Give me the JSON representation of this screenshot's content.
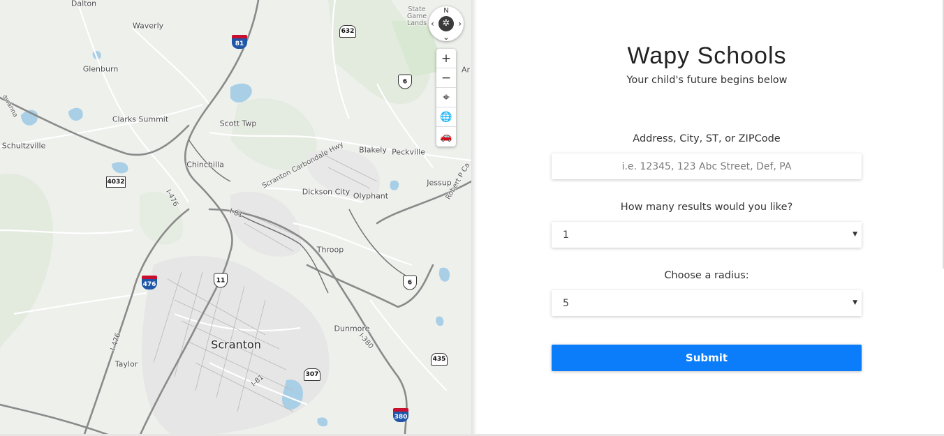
{
  "map": {
    "places": [
      {
        "name": "Dalton"
      },
      {
        "name": "Waverly"
      },
      {
        "name": "Glenburn"
      },
      {
        "name": "Clarks Summit"
      },
      {
        "name": "Scott Twp"
      },
      {
        "name": "Schultzville"
      },
      {
        "name": "Chinchilla"
      },
      {
        "name": "Blakely"
      },
      {
        "name": "Peckville"
      },
      {
        "name": "Dickson City"
      },
      {
        "name": "Olyphant"
      },
      {
        "name": "Jessup"
      },
      {
        "name": "Throop"
      },
      {
        "name": "Scranton"
      },
      {
        "name": "Dunmore"
      },
      {
        "name": "Taylor"
      },
      {
        "name": "State Game Lands"
      },
      {
        "name": "Ar"
      }
    ],
    "roads": [
      {
        "name": "Scranton Carbondale Hwy"
      },
      {
        "name": "I-476"
      },
      {
        "name": "I-81"
      },
      {
        "name": "I-380"
      },
      {
        "name": "I-476"
      },
      {
        "name": "I-81"
      },
      {
        "name": "Robert P Ca"
      },
      {
        "name": "awanna"
      }
    ],
    "shields": [
      {
        "num": "81",
        "type": "interstate"
      },
      {
        "num": "632",
        "type": "state"
      },
      {
        "num": "6",
        "type": "us"
      },
      {
        "num": "4032",
        "type": "county"
      },
      {
        "num": "476",
        "type": "interstate"
      },
      {
        "num": "11",
        "type": "us"
      },
      {
        "num": "6",
        "type": "us"
      },
      {
        "num": "307",
        "type": "state"
      },
      {
        "num": "435",
        "type": "state"
      },
      {
        "num": "380",
        "type": "interstate"
      }
    ],
    "controls": {
      "compass_label": "N",
      "zoom_in": "+",
      "zoom_out": "−",
      "locate": "⌖",
      "globe": "🌐",
      "car": "🚗"
    }
  },
  "form": {
    "title": "Wapy Schools",
    "subtitle": "Your child's future begins below",
    "address_label": "Address, City, ST, or ZIPCode",
    "address_placeholder": "i.e. 12345, 123 Abc Street, Def, PA",
    "address_value": "",
    "results_label": "How many results would you like?",
    "results_value": "1",
    "radius_label": "Choose a radius:",
    "radius_value": "5",
    "submit_label": "Submit"
  },
  "colors": {
    "submit": "#0b7dfa",
    "map_bg": "#eef0ec",
    "interstate_blue": "#1f56a8",
    "interstate_red": "#c8102e"
  }
}
